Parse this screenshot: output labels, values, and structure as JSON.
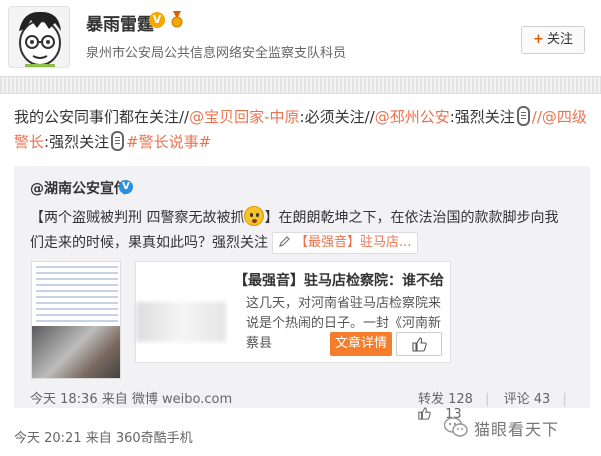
{
  "user": {
    "name": "暴雨雷霆",
    "verified": "V",
    "description": "泉州市公安局公共信息网络安全监察支队科员",
    "follow_label": "关注",
    "follow_plus": "+"
  },
  "post": {
    "text_parts": {
      "p1": "我的公安同事们都在关注//",
      "m1": "@宝贝回家-中原",
      "p2": ":必须关注//",
      "m2": "@邳州公安",
      "p3": ":强烈关注",
      "m3": "//@四级警长",
      "p4": ":强烈关注",
      "tag": "#警长说事#"
    },
    "meta": "今天 20:21 来自 360奇酷手机"
  },
  "repost": {
    "author": "@湖南公安宣传",
    "verified": "V",
    "text_a": "【两个盗贼被判刑 四警察无故被抓",
    "text_b": "】在朗朗乾坤之下，在依法治国的款款脚步向我们走来的时候，果真如此吗？强烈关注",
    "chip_label": "【最强音】驻马店...",
    "article": {
      "title": "【最强音】驻马店检察院：谁不给...",
      "summary": "这几天，对河南省驻马店检察院来说是个热闹的日子。一封《河南新蔡县",
      "detail_label": "文章详情"
    },
    "meta": "今天 18:36 来自 微博 weibo.com",
    "repost_label": "转发 128",
    "comment_label": "评论 43",
    "like_count": "13"
  },
  "watermark": {
    "text": "猫眼看天下"
  },
  "colors": {
    "link": "#eb7350",
    "button": "#f57c2a",
    "verified_orange": "#f6a700",
    "verified_blue": "#2d8fe3"
  }
}
